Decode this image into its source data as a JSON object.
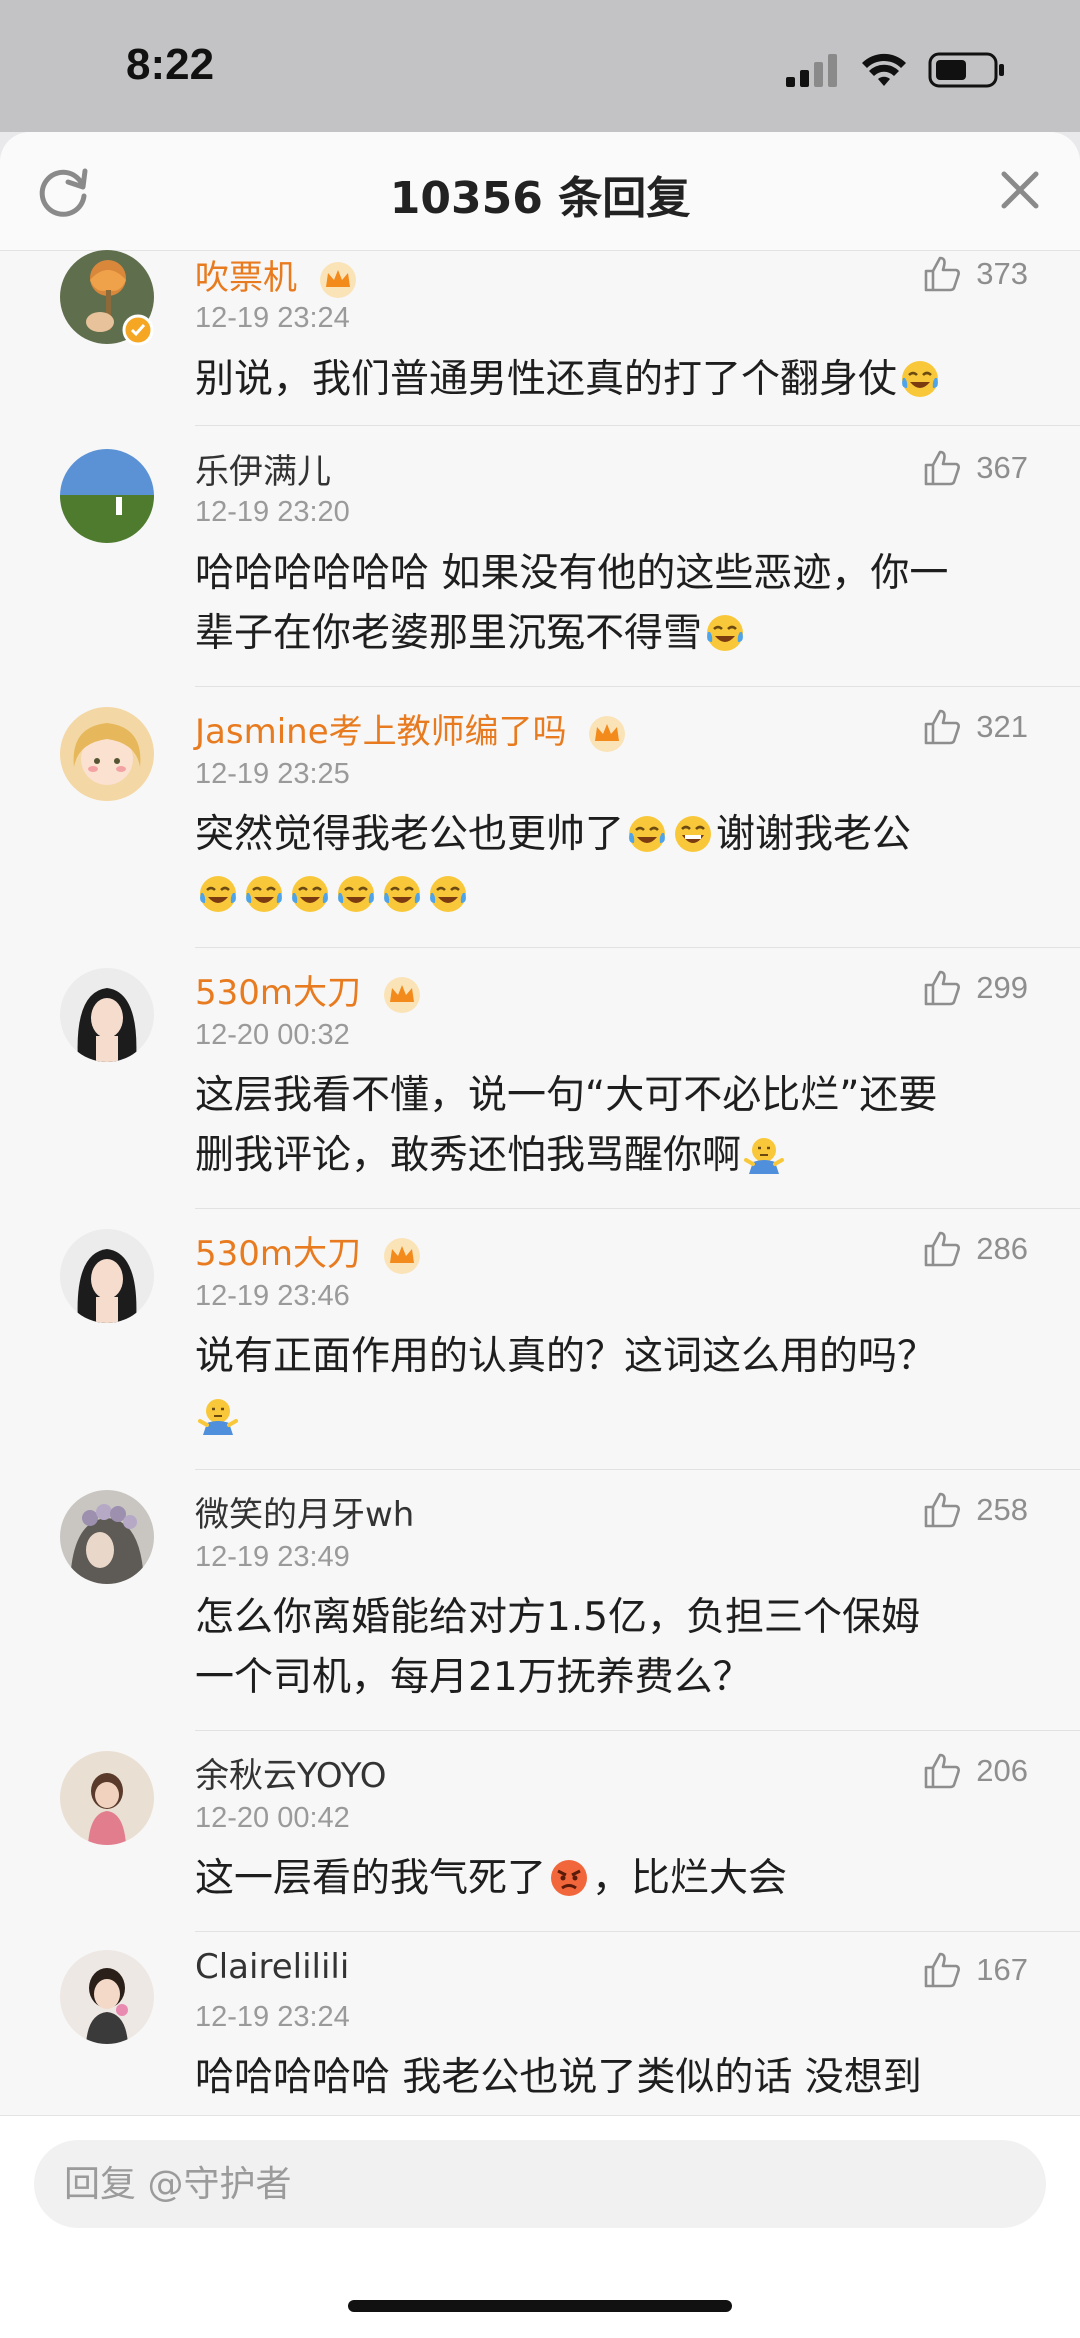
{
  "status": {
    "time": "8:22"
  },
  "header": {
    "title": "10356 条回复"
  },
  "comments": [
    {
      "user": "吹票机",
      "vip": true,
      "time": "12-19 23:24",
      "likes": "373",
      "lines": [
        "别说，我们普通男性还真的打了个翻身仗"
      ]
    },
    {
      "user": "乐伊满儿",
      "vip": false,
      "time": "12-19 23:20",
      "likes": "367",
      "lines": [
        "哈哈哈哈哈哈 如果没有他的这些恶迹，你一",
        "辈子在你老婆那里沉冤不得雪"
      ]
    },
    {
      "user": "Jasmine考上教师编了吗",
      "vip": true,
      "time": "12-19 23:25",
      "likes": "321",
      "lines": [
        "突然觉得我老公也更帅了",
        "谢谢我老公"
      ]
    },
    {
      "user": "530m大刀",
      "vip": true,
      "time": "12-20 00:32",
      "likes": "299",
      "lines": [
        "这层我看不懂，说一句“大可不必比烂”还要",
        "删我评论，敢秀还怕我骂醒你啊"
      ]
    },
    {
      "user": "530m大刀",
      "vip": true,
      "time": "12-19 23:46",
      "likes": "286",
      "lines": [
        "说有正面作用的认真的？这词这么用的吗？"
      ]
    },
    {
      "user": "微笑的月牙wh",
      "vip": false,
      "time": "12-19 23:49",
      "likes": "258",
      "lines": [
        "怎么你离婚能给对方1.5亿，负担三个保姆",
        "一个司机，每月21万抚养费么？"
      ]
    },
    {
      "user": "余秋云YOYO",
      "vip": false,
      "time": "12-20 00:42",
      "likes": "206",
      "lines": [
        "这一层看的我气死了",
        "，比烂大会"
      ]
    },
    {
      "user": "Clairelilili",
      "vip": false,
      "time": "12-19 23:24",
      "likes": "167",
      "lines": [
        "哈哈哈哈哈 我老公也说了类似的话 没想到"
      ]
    }
  ],
  "reply": {
    "placeholder": "回复 @守护者"
  },
  "icons": {
    "refresh": "refresh-icon",
    "close": "close-icon",
    "like": "thumbs-up-icon",
    "crown": "crown-badge-icon",
    "verified": "verified-badge-icon"
  },
  "colors": {
    "vip_name": "#e87b1f",
    "normal_name": "#333333",
    "time": "#9a9a9a"
  }
}
